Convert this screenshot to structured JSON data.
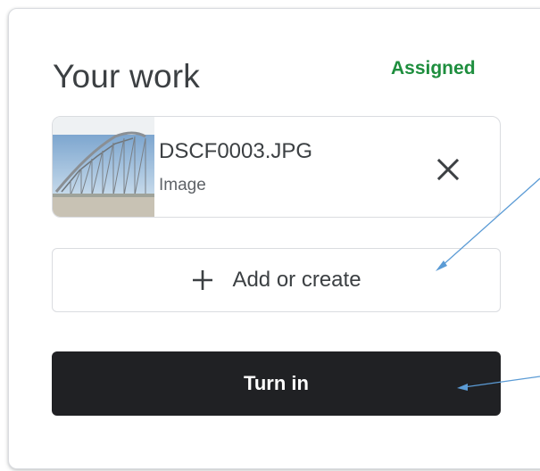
{
  "panel": {
    "title": "Your work",
    "status": "Assigned",
    "colors": {
      "status": "#1e8e3e",
      "primary_button": "#202124",
      "annotation_arrow": "#5b9bd5"
    }
  },
  "attachment": {
    "file_name": "DSCF0003.JPG",
    "file_type": "Image",
    "thumbnail_icon": "roller-coaster-photo",
    "remove_icon": "close-icon"
  },
  "actions": {
    "add_label": "Add or create",
    "add_icon": "plus-icon",
    "turn_in_label": "Turn in"
  }
}
